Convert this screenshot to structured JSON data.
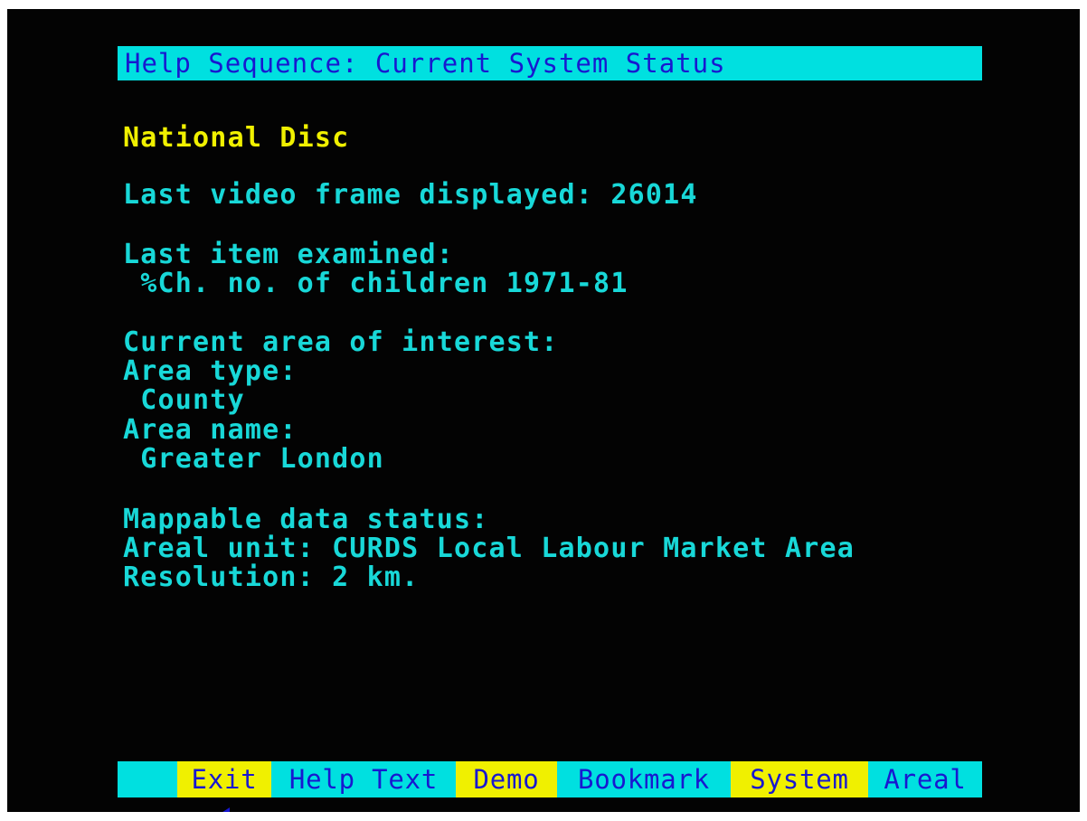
{
  "header": {
    "title": "Help Sequence: Current System Status"
  },
  "content": {
    "disc_name": "National Disc",
    "last_frame": "Last video frame displayed: 26014",
    "last_item_label": "Last item examined:",
    "last_item_value": " %Ch. no. of children 1971-81",
    "area_heading": "Current area of interest:",
    "area_type_label": "Area type:",
    "area_type_value": " County",
    "area_name_label": "Area name:",
    "area_name_value": " Greater London",
    "mappable_heading": "Mappable data status:",
    "areal_unit": "Areal unit: CURDS Local Labour Market Area",
    "resolution": "Resolution: 2 km."
  },
  "menu": {
    "back_icon": "left-triangle-icon",
    "exit_label": "Exit",
    "help_text_label": "Help Text",
    "demo_label": "Demo",
    "bookmark_label": "Bookmark",
    "system_label": "System",
    "areal_label": "Areal"
  },
  "colors": {
    "background": "#030303",
    "cyan": "#18d8d8",
    "yellow": "#f0f000",
    "bar_cyan": "#00e0e0",
    "bar_text": "#1818d0"
  }
}
